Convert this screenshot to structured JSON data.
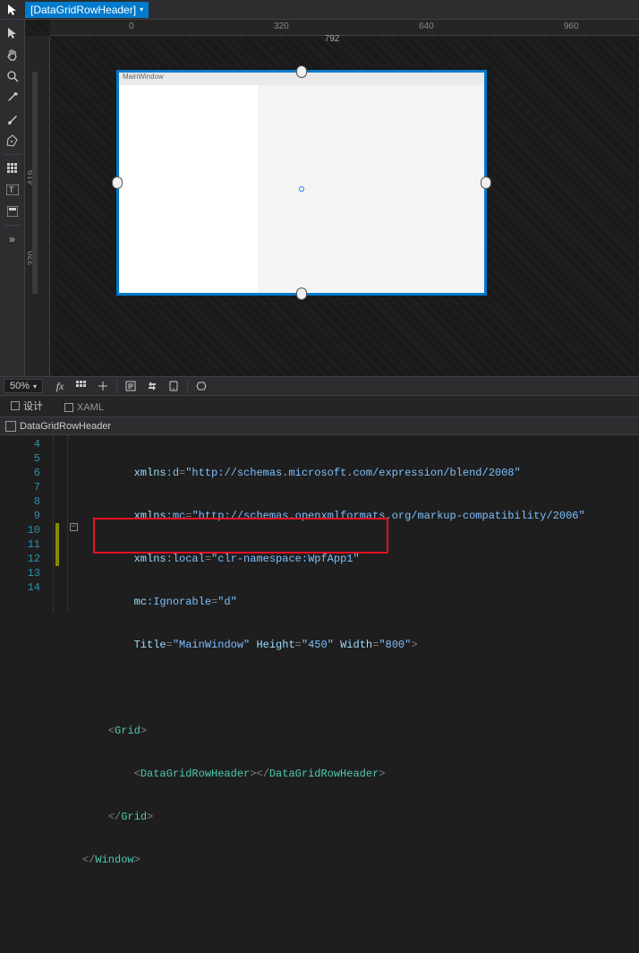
{
  "breadcrumb": {
    "label": "[DataGridRowHeader]"
  },
  "ruler": {
    "h0": "0",
    "h1": "320",
    "h2": "640",
    "h3": "960",
    "width_label": "792",
    "v0": "419",
    "v1": "320"
  },
  "window": {
    "title": "MainWindow"
  },
  "zoom": {
    "value": "50%"
  },
  "tabs": {
    "design": "设计",
    "xaml": "XAML"
  },
  "crumb2": {
    "label": "DataGridRowHeader"
  },
  "lines": {
    "n4": "4",
    "n5": "5",
    "n6": "6",
    "n7": "7",
    "n8": "8",
    "n9": "9",
    "n10": "10",
    "n11": "11",
    "n12": "12",
    "n13": "13",
    "n14": "14"
  },
  "code": {
    "l4_a": "xmlns",
    "l4_b": ":d",
    "l4_c": "=",
    "l4_d": "\"http://schemas.microsoft.com/expression/blend/2008\"",
    "l5_a": "xmlns",
    "l5_b": ":mc",
    "l5_c": "=",
    "l5_d": "\"http://schemas.openxmlformats.org/markup-compatibility/2006\"",
    "l6_a": "xmlns",
    "l6_b": ":local",
    "l6_c": "=",
    "l6_d": "\"clr-namespace:WpfApp1\"",
    "l7_a": "mc",
    "l7_b": ":Ignorable",
    "l7_c": "=",
    "l7_d": "\"d\"",
    "l8_a": "Title",
    "l8_b": "=",
    "l8_c": "\"MainWindow\"",
    "l8_d": " Height",
    "l8_e": "=",
    "l8_f": "\"450\"",
    "l8_g": " Width",
    "l8_h": "=",
    "l8_i": "\"800\"",
    "l8_j": ">",
    "l10_a": "<",
    "l10_b": "Grid",
    "l10_c": ">",
    "l11_a": "<",
    "l11_b": "DataGridRowHeader",
    "l11_c": "></",
    "l11_d": "DataGridRowHeader",
    "l11_e": ">",
    "l12_a": "</",
    "l12_b": "Grid",
    "l12_c": ">",
    "l13_a": "</",
    "l13_b": "Window",
    "l13_c": ">"
  }
}
